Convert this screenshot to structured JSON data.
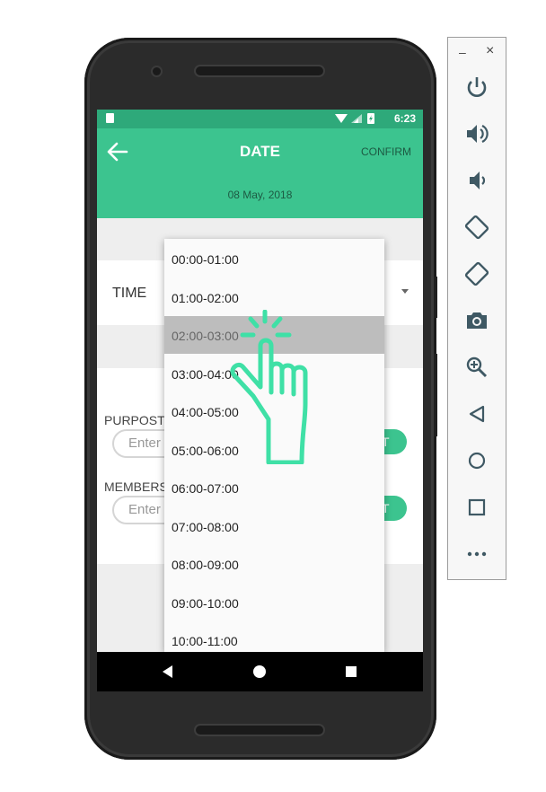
{
  "statusbar": {
    "time": "6:23"
  },
  "appbar": {
    "title": "DATE",
    "confirm_label": "CONFIRM",
    "date": "08 May, 2018"
  },
  "time_field": {
    "label": "TIME"
  },
  "form": {
    "purpose_label": "PURPOST",
    "purpose_placeholder": "Enter",
    "members_label": "MEMBERS",
    "members_placeholder": "Enter",
    "button_fragment": "T"
  },
  "dropdown": {
    "selected_index": 2,
    "options": [
      "00:00-01:00",
      "01:00-02:00",
      "02:00-03:00",
      "03:00-04:00",
      "04:00-05:00",
      "05:00-06:00",
      "06:00-07:00",
      "07:00-08:00",
      "08:00-09:00",
      "09:00-10:00",
      "10:00-11:00"
    ]
  },
  "emulator_toolbar": {
    "minimize": "–",
    "close": "×",
    "buttons": [
      "power-icon",
      "volume-up-icon",
      "volume-down-icon",
      "rotate-left-icon",
      "rotate-right-icon",
      "camera-icon",
      "zoom-icon",
      "back-icon",
      "home-icon",
      "overview-icon",
      "more-icon"
    ]
  },
  "colors": {
    "accent": "#3cc48f",
    "statusbar": "#2ea97a",
    "hand": "#3fe0a6"
  }
}
